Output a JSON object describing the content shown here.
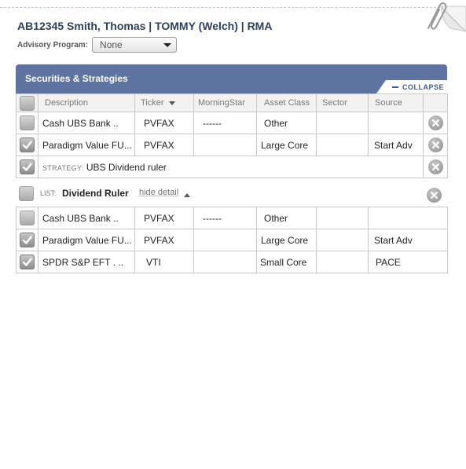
{
  "client": {
    "title": "AB12345 Smith, Thomas | TOMMY (Welch) | RMA"
  },
  "advisory": {
    "label": "Advisory Program:",
    "selected": "None"
  },
  "panel": {
    "title": "Securities & Strategies",
    "collapse_label": "COLLAPSE"
  },
  "columns": [
    "Description",
    "Ticker",
    "MorningStar",
    "Asset Class",
    "Sector",
    "Source"
  ],
  "rows": [
    {
      "checked": false,
      "description": "Cash UBS Bank ..",
      "ticker": "PVFAX",
      "morningstar": "------",
      "asset_class": "Other",
      "sector": "",
      "source": ""
    },
    {
      "checked": true,
      "description": "Paradigm Value FU...",
      "ticker": "PVFAX",
      "morningstar": "",
      "asset_class": "Large Core",
      "sector": "",
      "source": "Start Adv"
    }
  ],
  "strategy": {
    "checked": true,
    "prefix": "STRATEGY:",
    "name": "UBS Dividend ruler"
  },
  "list": {
    "checked": false,
    "prefix": "LIST:",
    "name": "Dividend Ruler",
    "hide_detail": "hide detail",
    "rows": [
      {
        "checked": false,
        "description": "Cash UBS Bank ..",
        "ticker": "PVFAX",
        "morningstar": "------",
        "asset_class": "Other",
        "sector": "",
        "source": ""
      },
      {
        "checked": true,
        "description": "Paradigm Value FU...",
        "ticker": "PVFAX",
        "morningstar": "",
        "asset_class": "Large Core",
        "sector": "",
        "source": "Start Adv"
      },
      {
        "checked": true,
        "description": "SPDR S&P EFT . ..",
        "ticker": "VTI",
        "morningstar": "",
        "asset_class": "Small Core",
        "sector": "",
        "source": "PACE"
      }
    ]
  },
  "colors": {
    "header_blue": "#5e739f",
    "title_navy": "#2d3f5c",
    "link_blue": "#3c5a8a"
  },
  "icons": {
    "attachment": "paperclip-icon",
    "remove": "close-circle-icon",
    "check": "checkmark-icon"
  }
}
